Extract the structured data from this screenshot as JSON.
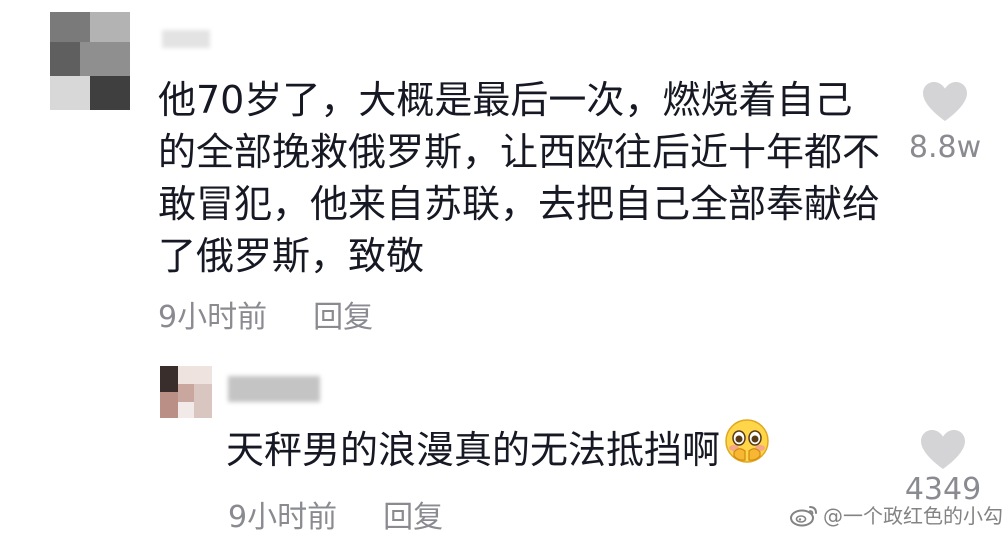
{
  "comment": {
    "text_lines": [
      "他70岁了，大概是最后一次，燃烧着自己",
      "的全部挽救俄罗斯，让西欧往后近十年都不",
      "敢冒犯，他来自苏联，去把自己全部奉献给",
      "了俄罗斯，致敬"
    ],
    "time": "9小时前",
    "reply_label": "回复",
    "likes": "8.8w",
    "like_icon": "heart-icon"
  },
  "reply": {
    "text": "天秤男的浪漫真的无法抵挡啊",
    "emoji_icon": "blushing-face-emoji",
    "time": "9小时前",
    "reply_label": "回复",
    "likes": "4349",
    "like_icon": "heart-icon"
  },
  "watermark": {
    "icon": "weibo-logo",
    "text": "@一个政红色的小勾"
  },
  "colors": {
    "text": "#161823",
    "meta": "#8a8b91",
    "heart": "#d4d4d6"
  }
}
